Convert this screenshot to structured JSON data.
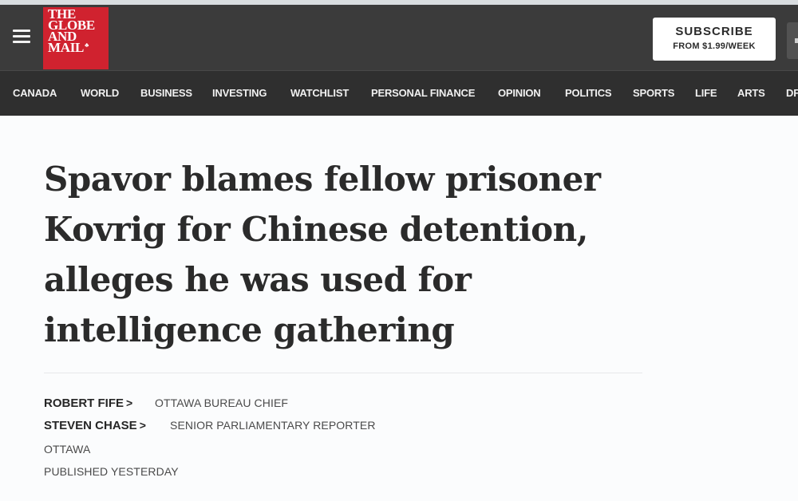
{
  "header": {
    "logo_lines": [
      "THE",
      "GLOBE",
      "AND",
      "MAIL"
    ],
    "subscribe": {
      "label": "SUBSCRIBE",
      "price": "FROM $1.99/WEEK"
    }
  },
  "nav": {
    "items": [
      "CANADA",
      "WORLD",
      "BUSINESS",
      "INVESTING",
      "WATCHLIST",
      "PERSONAL FINANCE",
      "OPINION",
      "POLITICS",
      "SPORTS",
      "LIFE",
      "ARTS",
      "DF"
    ]
  },
  "article": {
    "headline": "Spavor blames fellow prisoner Kovrig for Chinese detention, alleges he was used for intelligence gathering",
    "bylines": [
      {
        "name": "ROBERT FIFE",
        "chevron": ">",
        "role": "OTTAWA BUREAU CHIEF"
      },
      {
        "name": "STEVEN CHASE",
        "chevron": ">",
        "role": "SENIOR PARLIAMENTARY REPORTER"
      }
    ],
    "location": "OTTAWA",
    "published": "PUBLISHED YESTERDAY"
  },
  "icons": {
    "menu": "hamburger-menu-icon",
    "logo_mark": "maple-leaf-icon",
    "chevron": "chevron-right-icon"
  },
  "colors": {
    "brand_red": "#d0222f",
    "header_bg": "#3b3b3b",
    "nav_bg": "#2f2f2f",
    "page_bg": "#fbfcfd"
  }
}
